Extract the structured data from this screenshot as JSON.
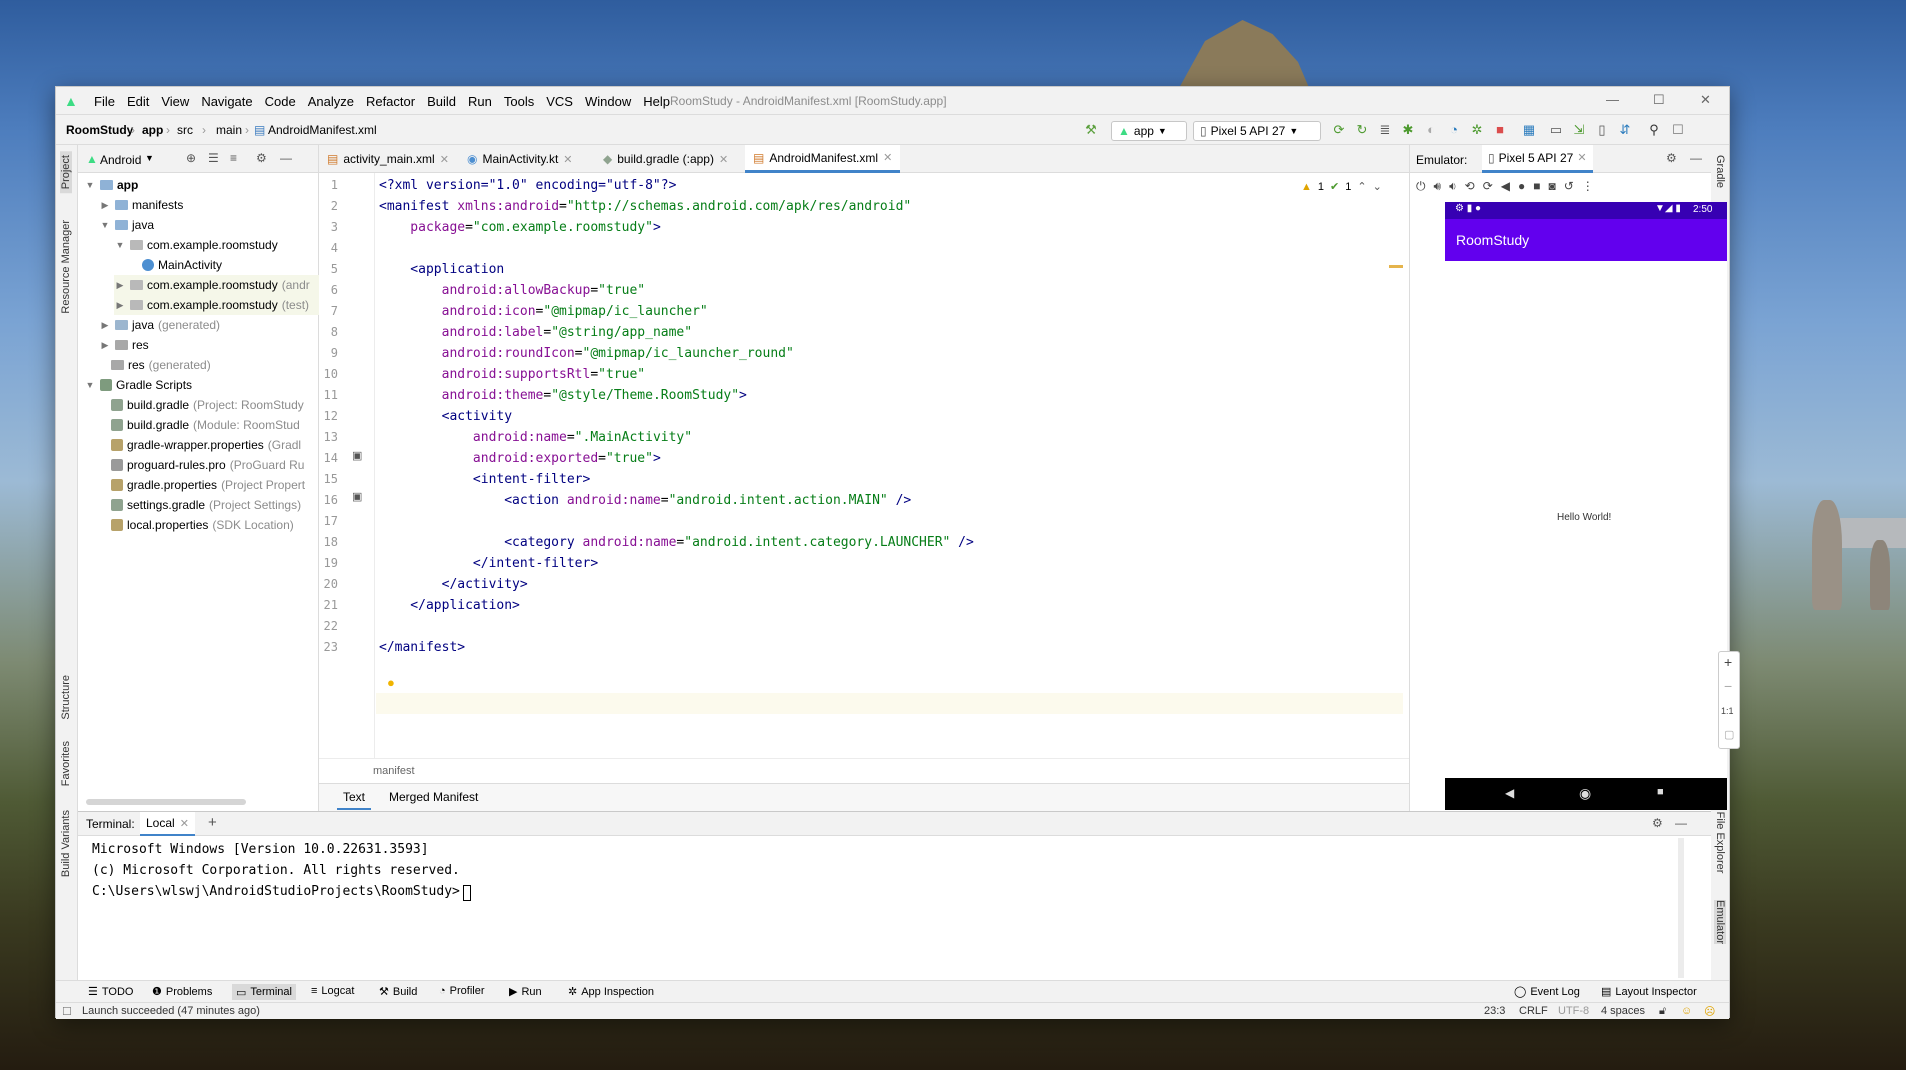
{
  "window": {
    "title": "RoomStudy - AndroidManifest.xml [RoomStudy.app]",
    "menu": [
      "File",
      "Edit",
      "View",
      "Navigate",
      "Code",
      "Analyze",
      "Refactor",
      "Build",
      "Run",
      "Tools",
      "VCS",
      "Window",
      "Help"
    ]
  },
  "breadcrumb": [
    "RoomStudy",
    "app",
    "src",
    "main",
    "AndroidManifest.xml"
  ],
  "toolbar": {
    "run_config": "app",
    "device": "Pixel 5 API 27"
  },
  "left_strip": [
    "Project",
    "Resource Manager",
    "Structure",
    "Favorites",
    "Build Variants"
  ],
  "right_strip": [
    "Gradle",
    "Device File Explorer",
    "Emulator"
  ],
  "project": {
    "view": "Android",
    "tree": [
      {
        "label": "app",
        "hint": ""
      },
      {
        "label": "manifests",
        "hint": ""
      },
      {
        "label": "java",
        "hint": ""
      },
      {
        "label": "com.example.roomstudy",
        "hint": ""
      },
      {
        "label": "MainActivity",
        "hint": ""
      },
      {
        "label": "com.example.roomstudy",
        "hint": "(andr"
      },
      {
        "label": "com.example.roomstudy",
        "hint": "(test)"
      },
      {
        "label": "java",
        "hint": "(generated)"
      },
      {
        "label": "res",
        "hint": ""
      },
      {
        "label": "res",
        "hint": "(generated)"
      },
      {
        "label": "Gradle Scripts",
        "hint": ""
      },
      {
        "label": "build.gradle",
        "hint": "(Project: RoomStudy"
      },
      {
        "label": "build.gradle",
        "hint": "(Module: RoomStud"
      },
      {
        "label": "gradle-wrapper.properties",
        "hint": "(Gradl"
      },
      {
        "label": "proguard-rules.pro",
        "hint": "(ProGuard Ru"
      },
      {
        "label": "gradle.properties",
        "hint": "(Project Propert"
      },
      {
        "label": "settings.gradle",
        "hint": "(Project Settings)"
      },
      {
        "label": "local.properties",
        "hint": "(SDK Location)"
      }
    ]
  },
  "editor": {
    "tabs": [
      "activity_main.xml",
      "MainActivity.kt",
      "build.gradle (:app)",
      "AndroidManifest.xml"
    ],
    "warnings": "1",
    "checks": "1",
    "breadcrumb": "manifest",
    "bottom_tabs": [
      "Text",
      "Merged Manifest"
    ],
    "line_numbers": [
      "1",
      "2",
      "3",
      "4",
      "5",
      "6",
      "7",
      "8",
      "9",
      "10",
      "11",
      "12",
      "13",
      "14",
      "15",
      "16",
      "17",
      "18",
      "19",
      "20",
      "21",
      "22",
      "23"
    ],
    "lines": [
      [
        {
          "t": "<?xml version=\"1.0\" encoding=\"utf-8\"?>",
          "c": "tag"
        }
      ],
      [
        {
          "t": "<manifest ",
          "c": "tag"
        },
        {
          "t": "xmlns:android",
          "c": "attr"
        },
        {
          "t": "=",
          "c": ""
        },
        {
          "t": "\"http://schemas.android.com/apk/res/android\"",
          "c": "val"
        }
      ],
      [
        {
          "t": "    package",
          "c": "attr"
        },
        {
          "t": "=",
          "c": ""
        },
        {
          "t": "\"com.example.roomstudy\"",
          "c": "val"
        },
        {
          "t": ">",
          "c": "tag"
        }
      ],
      [
        {
          "t": "",
          "c": ""
        }
      ],
      [
        {
          "t": "    <application",
          "c": "tag"
        }
      ],
      [
        {
          "t": "        android:allowBackup",
          "c": "attr"
        },
        {
          "t": "=",
          "c": ""
        },
        {
          "t": "\"true\"",
          "c": "val"
        }
      ],
      [
        {
          "t": "        android:icon",
          "c": "attr"
        },
        {
          "t": "=",
          "c": ""
        },
        {
          "t": "\"@mipmap/ic_launcher\"",
          "c": "val"
        }
      ],
      [
        {
          "t": "        android:label",
          "c": "attr"
        },
        {
          "t": "=",
          "c": ""
        },
        {
          "t": "\"@string/app_name\"",
          "c": "val"
        }
      ],
      [
        {
          "t": "        android:roundIcon",
          "c": "attr"
        },
        {
          "t": "=",
          "c": ""
        },
        {
          "t": "\"@mipmap/ic_launcher_round\"",
          "c": "val"
        }
      ],
      [
        {
          "t": "        android:supportsRtl",
          "c": "attr"
        },
        {
          "t": "=",
          "c": ""
        },
        {
          "t": "\"true\"",
          "c": "val"
        }
      ],
      [
        {
          "t": "        android:theme",
          "c": "attr"
        },
        {
          "t": "=",
          "c": ""
        },
        {
          "t": "\"@style/Theme.RoomStudy\"",
          "c": "val"
        },
        {
          "t": ">",
          "c": "tag"
        }
      ],
      [
        {
          "t": "        <activity",
          "c": "tag"
        }
      ],
      [
        {
          "t": "            android:name",
          "c": "attr"
        },
        {
          "t": "=",
          "c": ""
        },
        {
          "t": "\".MainActivity\"",
          "c": "val"
        }
      ],
      [
        {
          "t": "            android:exported",
          "c": "attr"
        },
        {
          "t": "=",
          "c": ""
        },
        {
          "t": "\"true\"",
          "c": "val"
        },
        {
          "t": ">",
          "c": "tag"
        }
      ],
      [
        {
          "t": "            <intent-filter>",
          "c": "tag"
        }
      ],
      [
        {
          "t": "                <action ",
          "c": "tag"
        },
        {
          "t": "android:name",
          "c": "attr"
        },
        {
          "t": "=",
          "c": ""
        },
        {
          "t": "\"android.intent.action.MAIN\"",
          "c": "val"
        },
        {
          "t": " />",
          "c": "tag"
        }
      ],
      [
        {
          "t": "",
          "c": ""
        }
      ],
      [
        {
          "t": "                <category ",
          "c": "tag"
        },
        {
          "t": "android:name",
          "c": "attr"
        },
        {
          "t": "=",
          "c": ""
        },
        {
          "t": "\"android.intent.category.LAUNCHER\"",
          "c": "val"
        },
        {
          "t": " />",
          "c": "tag"
        }
      ],
      [
        {
          "t": "            </intent-filter>",
          "c": "tag"
        }
      ],
      [
        {
          "t": "        </activity>",
          "c": "tag"
        }
      ],
      [
        {
          "t": "    </application>",
          "c": "tag"
        }
      ],
      [
        {
          "t": "",
          "c": ""
        }
      ],
      [
        {
          "t": "</manifest>",
          "c": "tag"
        }
      ]
    ]
  },
  "emulator": {
    "label": "Emulator:",
    "device_tab": "Pixel 5 API 27",
    "time": "2:50",
    "app_title": "RoomStudy",
    "content": "Hello World!",
    "zoom_ratio": "1:1",
    "app_bar_color": "#6200ee"
  },
  "terminal": {
    "label": "Terminal:",
    "tab": "Local",
    "lines": [
      "Microsoft Windows [Version 10.0.22631.3593]",
      "(c) Microsoft Corporation. All rights reserved.",
      "C:\\Users\\wlswj\\AndroidStudioProjects\\RoomStudy>"
    ]
  },
  "tool_windows": [
    "TODO",
    "Problems",
    "Terminal",
    "Logcat",
    "Build",
    "Profiler",
    "Run",
    "App Inspection"
  ],
  "tool_windows_right": [
    "Event Log",
    "Layout Inspector"
  ],
  "status": {
    "message": "Launch succeeded (47 minutes ago)",
    "position": "23:3",
    "line_sep": "CRLF",
    "encoding": "UTF-8",
    "indent": "4 spaces"
  }
}
